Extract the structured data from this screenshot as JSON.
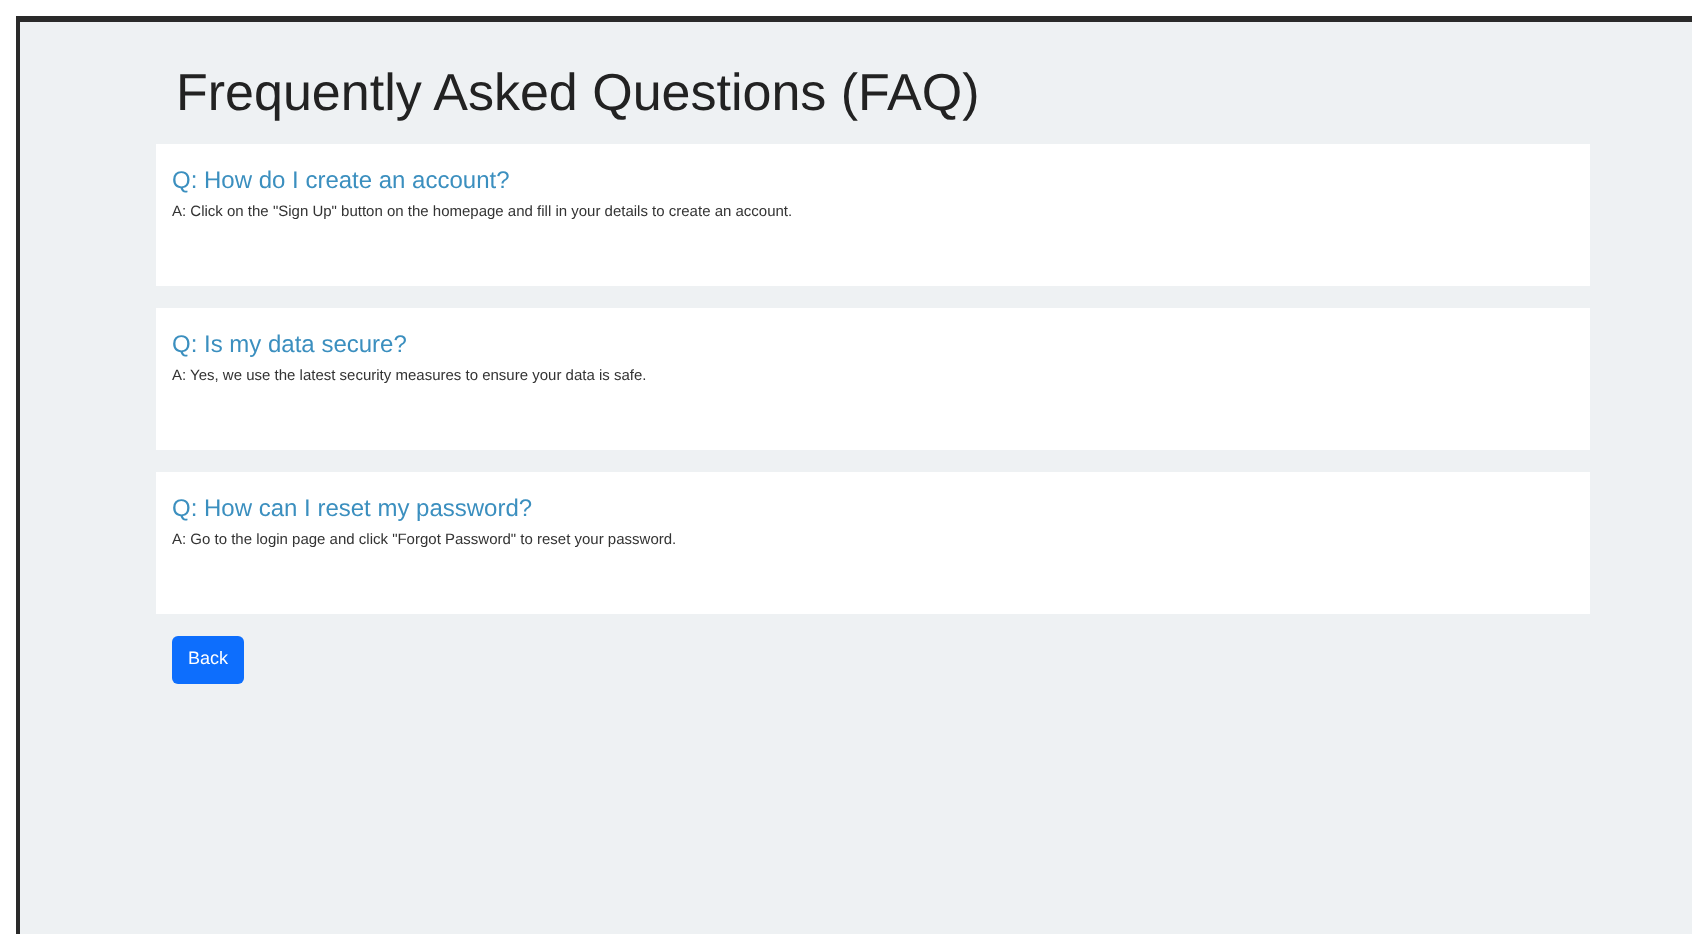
{
  "title": "Frequently Asked Questions (FAQ)",
  "faqs": [
    {
      "question": "Q: How do I create an account?",
      "answer": "A: Click on the \"Sign Up\" button on the homepage and fill in your details to create an account."
    },
    {
      "question": "Q: Is my data secure?",
      "answer": "A: Yes, we use the latest security measures to ensure your data is safe."
    },
    {
      "question": "Q: How can I reset my password?",
      "answer": "A: Go to the login page and click \"Forgot Password\" to reset your password."
    }
  ],
  "back_button": "Back"
}
